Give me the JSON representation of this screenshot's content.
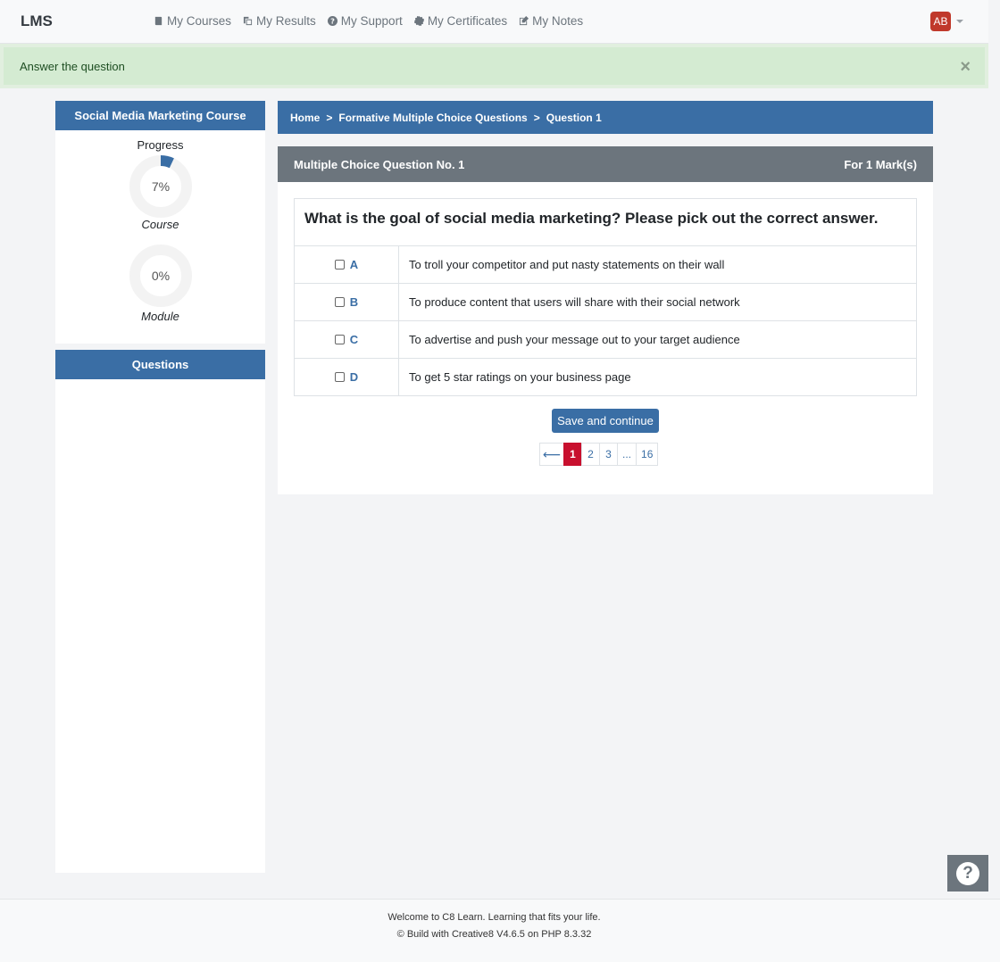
{
  "navbar": {
    "brand": "LMS",
    "items": [
      {
        "label": "My Courses",
        "icon": "book-icon"
      },
      {
        "label": "My Results",
        "icon": "copy-icon"
      },
      {
        "label": "My Support",
        "icon": "question-circle-icon"
      },
      {
        "label": "My Certificates",
        "icon": "certificate-icon"
      },
      {
        "label": "My Notes",
        "icon": "edit-icon"
      }
    ],
    "avatar_initials": "AB"
  },
  "alert": {
    "message": "Answer the question",
    "close": "×"
  },
  "sidebar": {
    "course_title": "Social Media Marketing Course",
    "progress_label": "Progress",
    "course_progress": {
      "value": 7,
      "text": "7%",
      "caption": "Course"
    },
    "module_progress": {
      "value": 0,
      "text": "0%",
      "caption": "Module"
    },
    "questions_title": "Questions"
  },
  "breadcrumb": {
    "items": [
      "Home",
      "Formative Multiple Choice Questions",
      "Question 1"
    ],
    "separator": ">"
  },
  "question": {
    "header": "Multiple Choice Question No. 1",
    "marks": "For 1 Mark(s)",
    "text": "What is the goal of social media marketing? Please pick out the correct answer.",
    "options": [
      {
        "letter": "A",
        "text": "To troll your competitor and put nasty statements on their wall"
      },
      {
        "letter": "B",
        "text": "To produce content that users will share with their social network"
      },
      {
        "letter": "C",
        "text": "To advertise and push your message out to your target audience"
      },
      {
        "letter": "D",
        "text": "To get 5 star ratings on your business page"
      }
    ],
    "save_label": "Save and continue"
  },
  "pagination": {
    "prev": "⟵",
    "pages": [
      "1",
      "2",
      "3",
      "...",
      "16"
    ],
    "active": "1"
  },
  "footer": {
    "line1": "Welcome to C8 Learn. Learning that fits your life.",
    "line2": "© Build with Creative8 V4.6.5 on PHP 8.3.32"
  },
  "colors": {
    "primary": "#3a6ea5",
    "active_page": "#c8102e",
    "card_header": "#6c757d",
    "alert_bg": "#d4ebd2",
    "avatar": "#c0392b"
  }
}
